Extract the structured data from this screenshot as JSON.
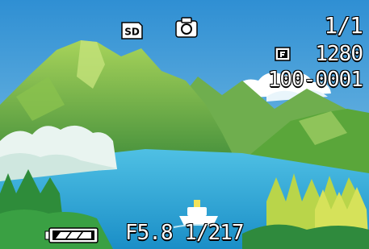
{
  "osd": {
    "frame_counter": "1/1",
    "resolution": "1280",
    "file_number": "100-0001",
    "aperture": "F5.8",
    "shutter": "1/217",
    "sd_label": "SD"
  },
  "icons": {
    "sd_card": "sd-card-icon",
    "camera_mode": "still-camera-icon",
    "quality_fine": "fine-quality-icon",
    "battery": "battery-full-icon"
  },
  "colors": {
    "sky": "#3f9ad8",
    "water": "#2aa7d6",
    "mountain": "#5aa63a",
    "osd_text": "#ffffff"
  }
}
